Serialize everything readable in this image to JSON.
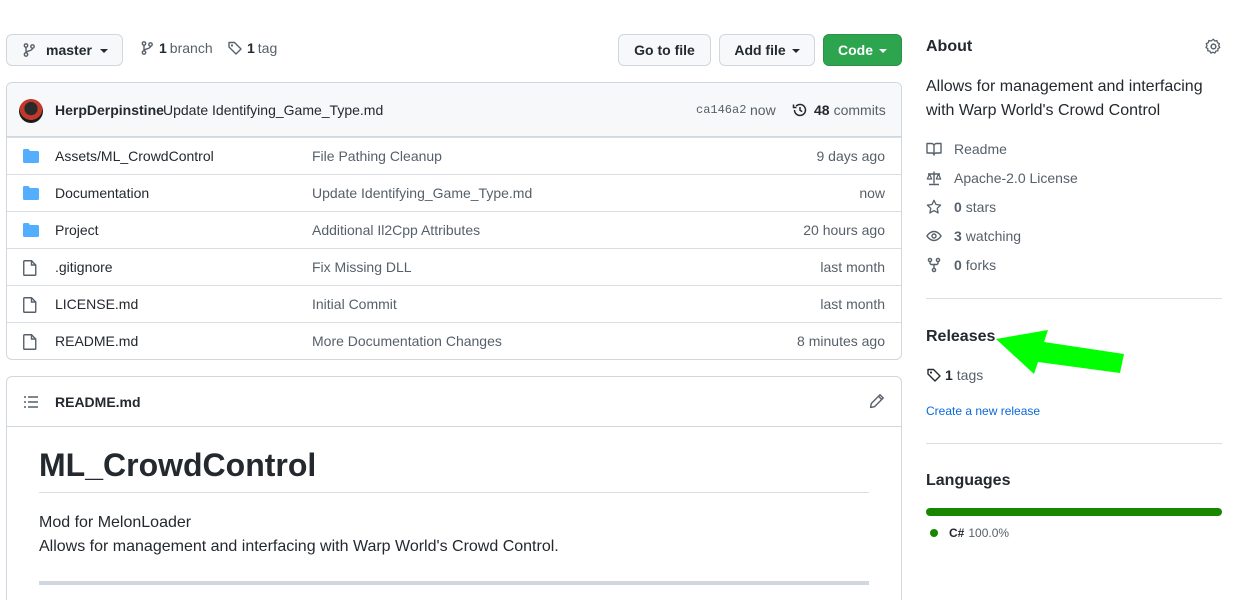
{
  "toolbar": {
    "branch_select": "master",
    "branches_count": "1",
    "branches_label": "branch",
    "tags_count": "1",
    "tags_label": "tag",
    "go_to_file": "Go to file",
    "add_file": "Add file",
    "code": "Code"
  },
  "commit": {
    "author": "HerpDerpinstine",
    "message": "Update Identifying_Game_Type.md",
    "sha": "ca146a2",
    "time": "now",
    "count": "48",
    "count_label": "commits"
  },
  "files": [
    {
      "type": "folder",
      "name": "Assets/ML_CrowdControl",
      "message": "File Pathing Cleanup",
      "age": "9 days ago"
    },
    {
      "type": "folder",
      "name": "Documentation",
      "message": "Update Identifying_Game_Type.md",
      "age": "now"
    },
    {
      "type": "folder",
      "name": "Project",
      "message": "Additional Il2Cpp Attributes",
      "age": "20 hours ago"
    },
    {
      "type": "file",
      "name": ".gitignore",
      "message": "Fix Missing DLL",
      "age": "last month"
    },
    {
      "type": "file",
      "name": "LICENSE.md",
      "message": "Initial Commit",
      "age": "last month"
    },
    {
      "type": "file",
      "name": "README.md",
      "message": "More Documentation Changes",
      "age": "8 minutes ago"
    }
  ],
  "readme": {
    "filename": "README.md",
    "heading": "ML_CrowdControl",
    "line1": "Mod for MelonLoader",
    "line2": "Allows for management and interfacing with Warp World's Crowd Control."
  },
  "about": {
    "title": "About",
    "description": "Allows for management and interfacing with Warp World's Crowd Control",
    "readme": "Readme",
    "license": "Apache-2.0 License",
    "stars_count": "0",
    "stars_label": "stars",
    "watching_count": "3",
    "watching_label": "watching",
    "forks_count": "0",
    "forks_label": "forks"
  },
  "releases": {
    "title": "Releases",
    "tags_count": "1",
    "tags_label": "tags",
    "create_link": "Create a new release"
  },
  "languages": {
    "title": "Languages",
    "items": [
      {
        "name": "C#",
        "percent": "100.0%",
        "color": "#178600"
      }
    ]
  },
  "colors": {
    "accent_green": "#2da44e",
    "link_blue": "#0969da",
    "folder_blue": "#54aeff",
    "annotation_arrow": "#00ff00"
  }
}
